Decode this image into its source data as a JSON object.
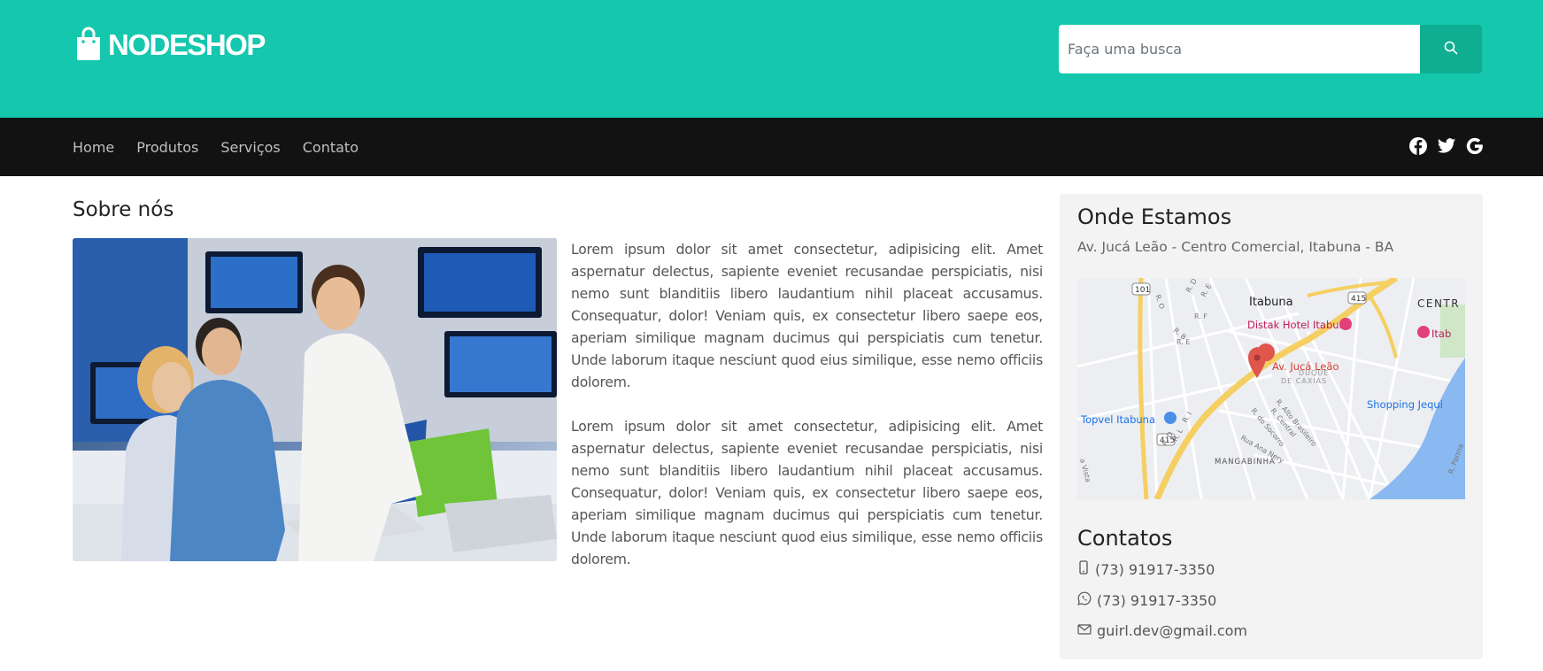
{
  "header": {
    "brand": "NODESHOP",
    "search_placeholder": "Faça uma busca"
  },
  "nav": {
    "items": [
      {
        "label": "Home"
      },
      {
        "label": "Produtos"
      },
      {
        "label": "Serviços"
      },
      {
        "label": "Contato"
      }
    ],
    "social": [
      "facebook-icon",
      "twitter-icon",
      "google-icon"
    ]
  },
  "about": {
    "title": "Sobre nós",
    "paragraphs": [
      "Lorem ipsum dolor sit amet consectetur, adipisicing elit. Amet aspernatur delectus, sapiente eveniet recusandae perspiciatis, nisi nemo sunt blanditiis libero laudantium nihil placeat accusamus. Consequatur, dolor! Veniam quis, ex consectetur libero saepe eos, aperiam similique magnam ducimus qui perspiciatis cum tenetur. Unde laborum itaque nesciunt quod eius similique, esse nemo officiis dolorem.",
      "Lorem ipsum dolor sit amet consectetur, adipisicing elit. Amet aspernatur delectus, sapiente eveniet recusandae perspiciatis, nisi nemo sunt blanditiis libero laudantium nihil placeat accusamus. Consequatur, dolor! Veniam quis, ex consectetur libero saepe eos, aperiam similique magnam ducimus qui perspiciatis cum tenetur. Unde laborum itaque nesciunt quod eius similique, esse nemo officiis dolorem."
    ]
  },
  "location": {
    "title": "Onde Estamos",
    "address": "Av. Jucá Leão - Centro Comercial, Itabuna - BA",
    "map": {
      "labels": {
        "city": "Itabuna",
        "centro": "CENTR",
        "hotel": "Distak Hotel Itabuna",
        "hotel_right": "Itab",
        "pin": "Av. Jucá Leão",
        "duque": "DUQUE",
        "caxias": "DE CAXIAS",
        "topvel": "Topvel Itabuna",
        "shopping": "Shopping Jequi",
        "mangabinha": "MANGABINHA",
        "alto_brasileiro": "R. Alto Brasileiro",
        "central": "R. Central",
        "socorro": "R. do Socorro",
        "ana_nery": "Rua Ana Nery",
        "road_101": "101",
        "road_415a": "415",
        "road_415b": "415",
        "rd": "R. D",
        "re": "R. E",
        "re2": "R. E",
        "rf": "R. F",
        "rb": "R. B",
        "ro": "R. O",
        "ri": "R. I",
        "rl": "R. L",
        "rd2": "R. D",
        "vista": "a Vista",
        "parma": "R. Parma"
      }
    }
  },
  "contacts": {
    "title": "Contatos",
    "phone": "(73) 91917-3350",
    "whatsapp": "(73) 91917-3350",
    "email": "guirl.dev@gmail.com"
  }
}
